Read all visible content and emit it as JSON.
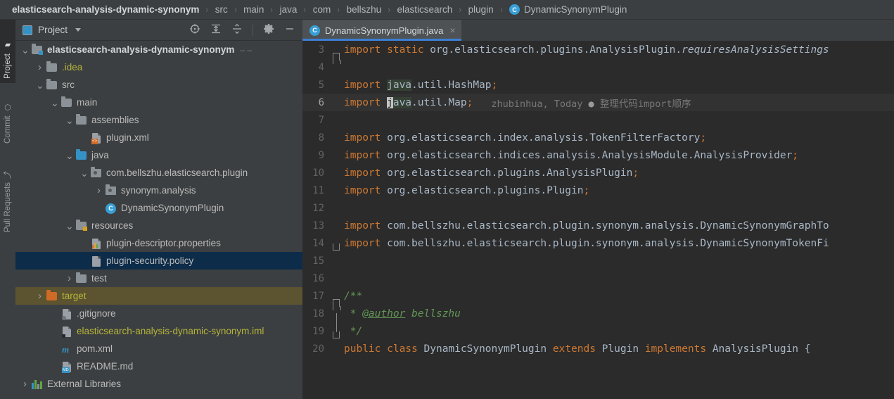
{
  "breadcrumb": {
    "items": [
      {
        "label": "elasticsearch-analysis-dynamic-synonym",
        "root": true
      },
      {
        "label": "src"
      },
      {
        "label": "main"
      },
      {
        "label": "java"
      },
      {
        "label": "com"
      },
      {
        "label": "bellszhu"
      },
      {
        "label": "elasticsearch"
      },
      {
        "label": "plugin"
      },
      {
        "label": "DynamicSynonymPlugin",
        "badge": "C"
      }
    ],
    "separator": "›"
  },
  "toolstrip": {
    "tabs": [
      {
        "label": "Project",
        "icon": "project-folder-icon",
        "active": true
      },
      {
        "label": "Commit",
        "icon": "commit-icon",
        "active": false
      },
      {
        "label": "Pull Requests",
        "icon": "pull-request-icon",
        "active": false
      }
    ]
  },
  "project_panel": {
    "title": "Project",
    "icon": "project-view-icon",
    "dropdown_icon": "chevron-down-icon",
    "actions": [
      {
        "name": "select-opened-file-icon",
        "label": "Select Opened File"
      },
      {
        "name": "expand-all-icon",
        "label": "Expand All"
      },
      {
        "name": "collapse-all-icon",
        "label": "Collapse All"
      },
      {
        "name": "settings-gear-icon",
        "label": "Settings"
      },
      {
        "name": "hide-panel-icon",
        "label": "Hide"
      }
    ],
    "tree": [
      {
        "label": "elasticsearch-analysis-dynamic-synonym",
        "depth": 0,
        "arrow": "down",
        "icon": "module-folder-icon",
        "style": "bold",
        "trailing": "– –"
      },
      {
        "label": ".idea",
        "depth": 1,
        "arrow": "right",
        "icon": "folder-icon",
        "style": "yellow"
      },
      {
        "label": "src",
        "depth": 1,
        "arrow": "down",
        "icon": "folder-icon",
        "style": "normal"
      },
      {
        "label": "main",
        "depth": 2,
        "arrow": "down",
        "icon": "folder-icon",
        "style": "normal"
      },
      {
        "label": "assemblies",
        "depth": 3,
        "arrow": "down",
        "icon": "folder-icon",
        "style": "normal"
      },
      {
        "label": "plugin.xml",
        "depth": 4,
        "arrow": "none",
        "icon": "xml-file-icon",
        "style": "normal"
      },
      {
        "label": "java",
        "depth": 3,
        "arrow": "down",
        "icon": "source-folder-icon",
        "style": "normal"
      },
      {
        "label": "com.bellszhu.elasticsearch.plugin",
        "depth": 4,
        "arrow": "down",
        "icon": "package-icon",
        "style": "normal"
      },
      {
        "label": "synonym.analysis",
        "depth": 5,
        "arrow": "right",
        "icon": "package-icon",
        "style": "normal"
      },
      {
        "label": "DynamicSynonymPlugin",
        "depth": 5,
        "arrow": "none",
        "icon": "java-class-icon",
        "style": "normal"
      },
      {
        "label": "resources",
        "depth": 3,
        "arrow": "down",
        "icon": "resources-folder-icon",
        "style": "normal"
      },
      {
        "label": "plugin-descriptor.properties",
        "depth": 4,
        "arrow": "none",
        "icon": "properties-file-icon",
        "style": "normal"
      },
      {
        "label": "plugin-security.policy",
        "depth": 4,
        "arrow": "none",
        "icon": "policy-file-icon",
        "style": "normal",
        "selected": true
      },
      {
        "label": "test",
        "depth": 3,
        "arrow": "right",
        "icon": "folder-icon",
        "style": "normal"
      },
      {
        "label": "target",
        "depth": 1,
        "arrow": "right",
        "icon": "excluded-folder-icon",
        "style": "yellow",
        "selected2": true
      },
      {
        "label": ".gitignore",
        "depth": 2,
        "arrow": "none",
        "icon": "gitignore-file-icon",
        "style": "normal"
      },
      {
        "label": "elasticsearch-analysis-dynamic-synonym.iml",
        "depth": 2,
        "arrow": "none",
        "icon": "iml-file-icon",
        "style": "yellow"
      },
      {
        "label": "pom.xml",
        "depth": 2,
        "arrow": "none",
        "icon": "maven-file-icon",
        "style": "normal"
      },
      {
        "label": "README.md",
        "depth": 2,
        "arrow": "none",
        "icon": "markdown-file-icon",
        "style": "normal"
      },
      {
        "label": "External Libraries",
        "depth": 0,
        "arrow": "right",
        "icon": "libraries-icon",
        "style": "normal"
      }
    ]
  },
  "editor": {
    "tab": {
      "label": "DynamicSynonymPlugin.java",
      "badge": "C",
      "close": "×"
    },
    "annotation": {
      "author": "zhubinhua",
      "date": "Today",
      "dot": "●",
      "message": "整理代码import顺序"
    },
    "current_line": 6,
    "lines": [
      {
        "n": 3,
        "fold": "top",
        "parts": [
          {
            "t": "import ",
            "c": "kw"
          },
          {
            "t": "static ",
            "c": "kw"
          },
          {
            "t": "org.elasticsearch.plugins.AnalysisPlugin.",
            "c": "id"
          },
          {
            "t": "requiresAnalysisSettings",
            "c": "id ital"
          }
        ]
      },
      {
        "n": 4,
        "fold": "",
        "parts": []
      },
      {
        "n": 5,
        "fold": "",
        "parts": [
          {
            "t": "import ",
            "c": "kw"
          },
          {
            "t": "java",
            "c": "id hl"
          },
          {
            "t": ".util.HashMap",
            "c": "id"
          },
          {
            "t": ";",
            "c": "kw"
          }
        ]
      },
      {
        "n": 6,
        "fold": "",
        "parts": [
          {
            "t": "import ",
            "c": "kw"
          },
          {
            "t": "j",
            "c": "cursor"
          },
          {
            "t": "ava",
            "c": "id hl"
          },
          {
            "t": ".util.Map",
            "c": "id"
          },
          {
            "t": ";",
            "c": "kw"
          }
        ],
        "annotated": true
      },
      {
        "n": 7,
        "fold": "",
        "parts": []
      },
      {
        "n": 8,
        "fold": "",
        "parts": [
          {
            "t": "import ",
            "c": "kw"
          },
          {
            "t": "org.elasticsearch.index.analysis.TokenFilterFactory",
            "c": "id"
          },
          {
            "t": ";",
            "c": "kw"
          }
        ]
      },
      {
        "n": 9,
        "fold": "",
        "parts": [
          {
            "t": "import ",
            "c": "kw"
          },
          {
            "t": "org.elasticsearch.indices.analysis.AnalysisModule.AnalysisProvider",
            "c": "id"
          },
          {
            "t": ";",
            "c": "kw"
          }
        ]
      },
      {
        "n": 10,
        "fold": "",
        "parts": [
          {
            "t": "import ",
            "c": "kw"
          },
          {
            "t": "org.elasticsearch.plugins.AnalysisPlugin",
            "c": "id"
          },
          {
            "t": ";",
            "c": "kw"
          }
        ]
      },
      {
        "n": 11,
        "fold": "",
        "parts": [
          {
            "t": "import ",
            "c": "kw"
          },
          {
            "t": "org.elasticsearch.plugins.Plugin",
            "c": "id"
          },
          {
            "t": ";",
            "c": "kw"
          }
        ]
      },
      {
        "n": 12,
        "fold": "",
        "parts": []
      },
      {
        "n": 13,
        "fold": "",
        "parts": [
          {
            "t": "import ",
            "c": "kw"
          },
          {
            "t": "com.bellszhu.elasticsearch.plugin.synonym.analysis.DynamicSynonymGraphTo",
            "c": "id"
          }
        ]
      },
      {
        "n": 14,
        "fold": "end",
        "parts": [
          {
            "t": "import ",
            "c": "kw"
          },
          {
            "t": "com.bellszhu.elasticsearch.plugin.synonym.analysis.DynamicSynonymTokenFi",
            "c": "id"
          }
        ]
      },
      {
        "n": 15,
        "fold": "",
        "parts": []
      },
      {
        "n": 16,
        "fold": "",
        "parts": []
      },
      {
        "n": 17,
        "fold": "top",
        "parts": [
          {
            "t": "/**",
            "c": "cmt"
          }
        ]
      },
      {
        "n": 18,
        "fold": "bar",
        "parts": [
          {
            "t": " * ",
            "c": "cmt"
          },
          {
            "t": "@author",
            "c": "cmt underline"
          },
          {
            "t": " bellszhu",
            "c": "cmt"
          }
        ]
      },
      {
        "n": 19,
        "fold": "end",
        "parts": [
          {
            "t": " */",
            "c": "cmt"
          }
        ]
      },
      {
        "n": 20,
        "fold": "",
        "parts": [
          {
            "t": "public ",
            "c": "kw"
          },
          {
            "t": "class ",
            "c": "kw"
          },
          {
            "t": "DynamicSynonymPlugin ",
            "c": "id"
          },
          {
            "t": "extends ",
            "c": "kw"
          },
          {
            "t": "Plugin ",
            "c": "id"
          },
          {
            "t": "implements ",
            "c": "kw"
          },
          {
            "t": "AnalysisPlugin ",
            "c": "id"
          },
          {
            "t": "{",
            "c": "id"
          }
        ]
      }
    ]
  },
  "colors": {
    "background": "#3c3f41",
    "editor_background": "#2b2b2b",
    "keyword": "#cc7832",
    "identifier": "#a9b7c6",
    "comment": "#629755",
    "accent": "#3592c4",
    "selection": "#0d2c49",
    "excluded": "#5c5330"
  }
}
